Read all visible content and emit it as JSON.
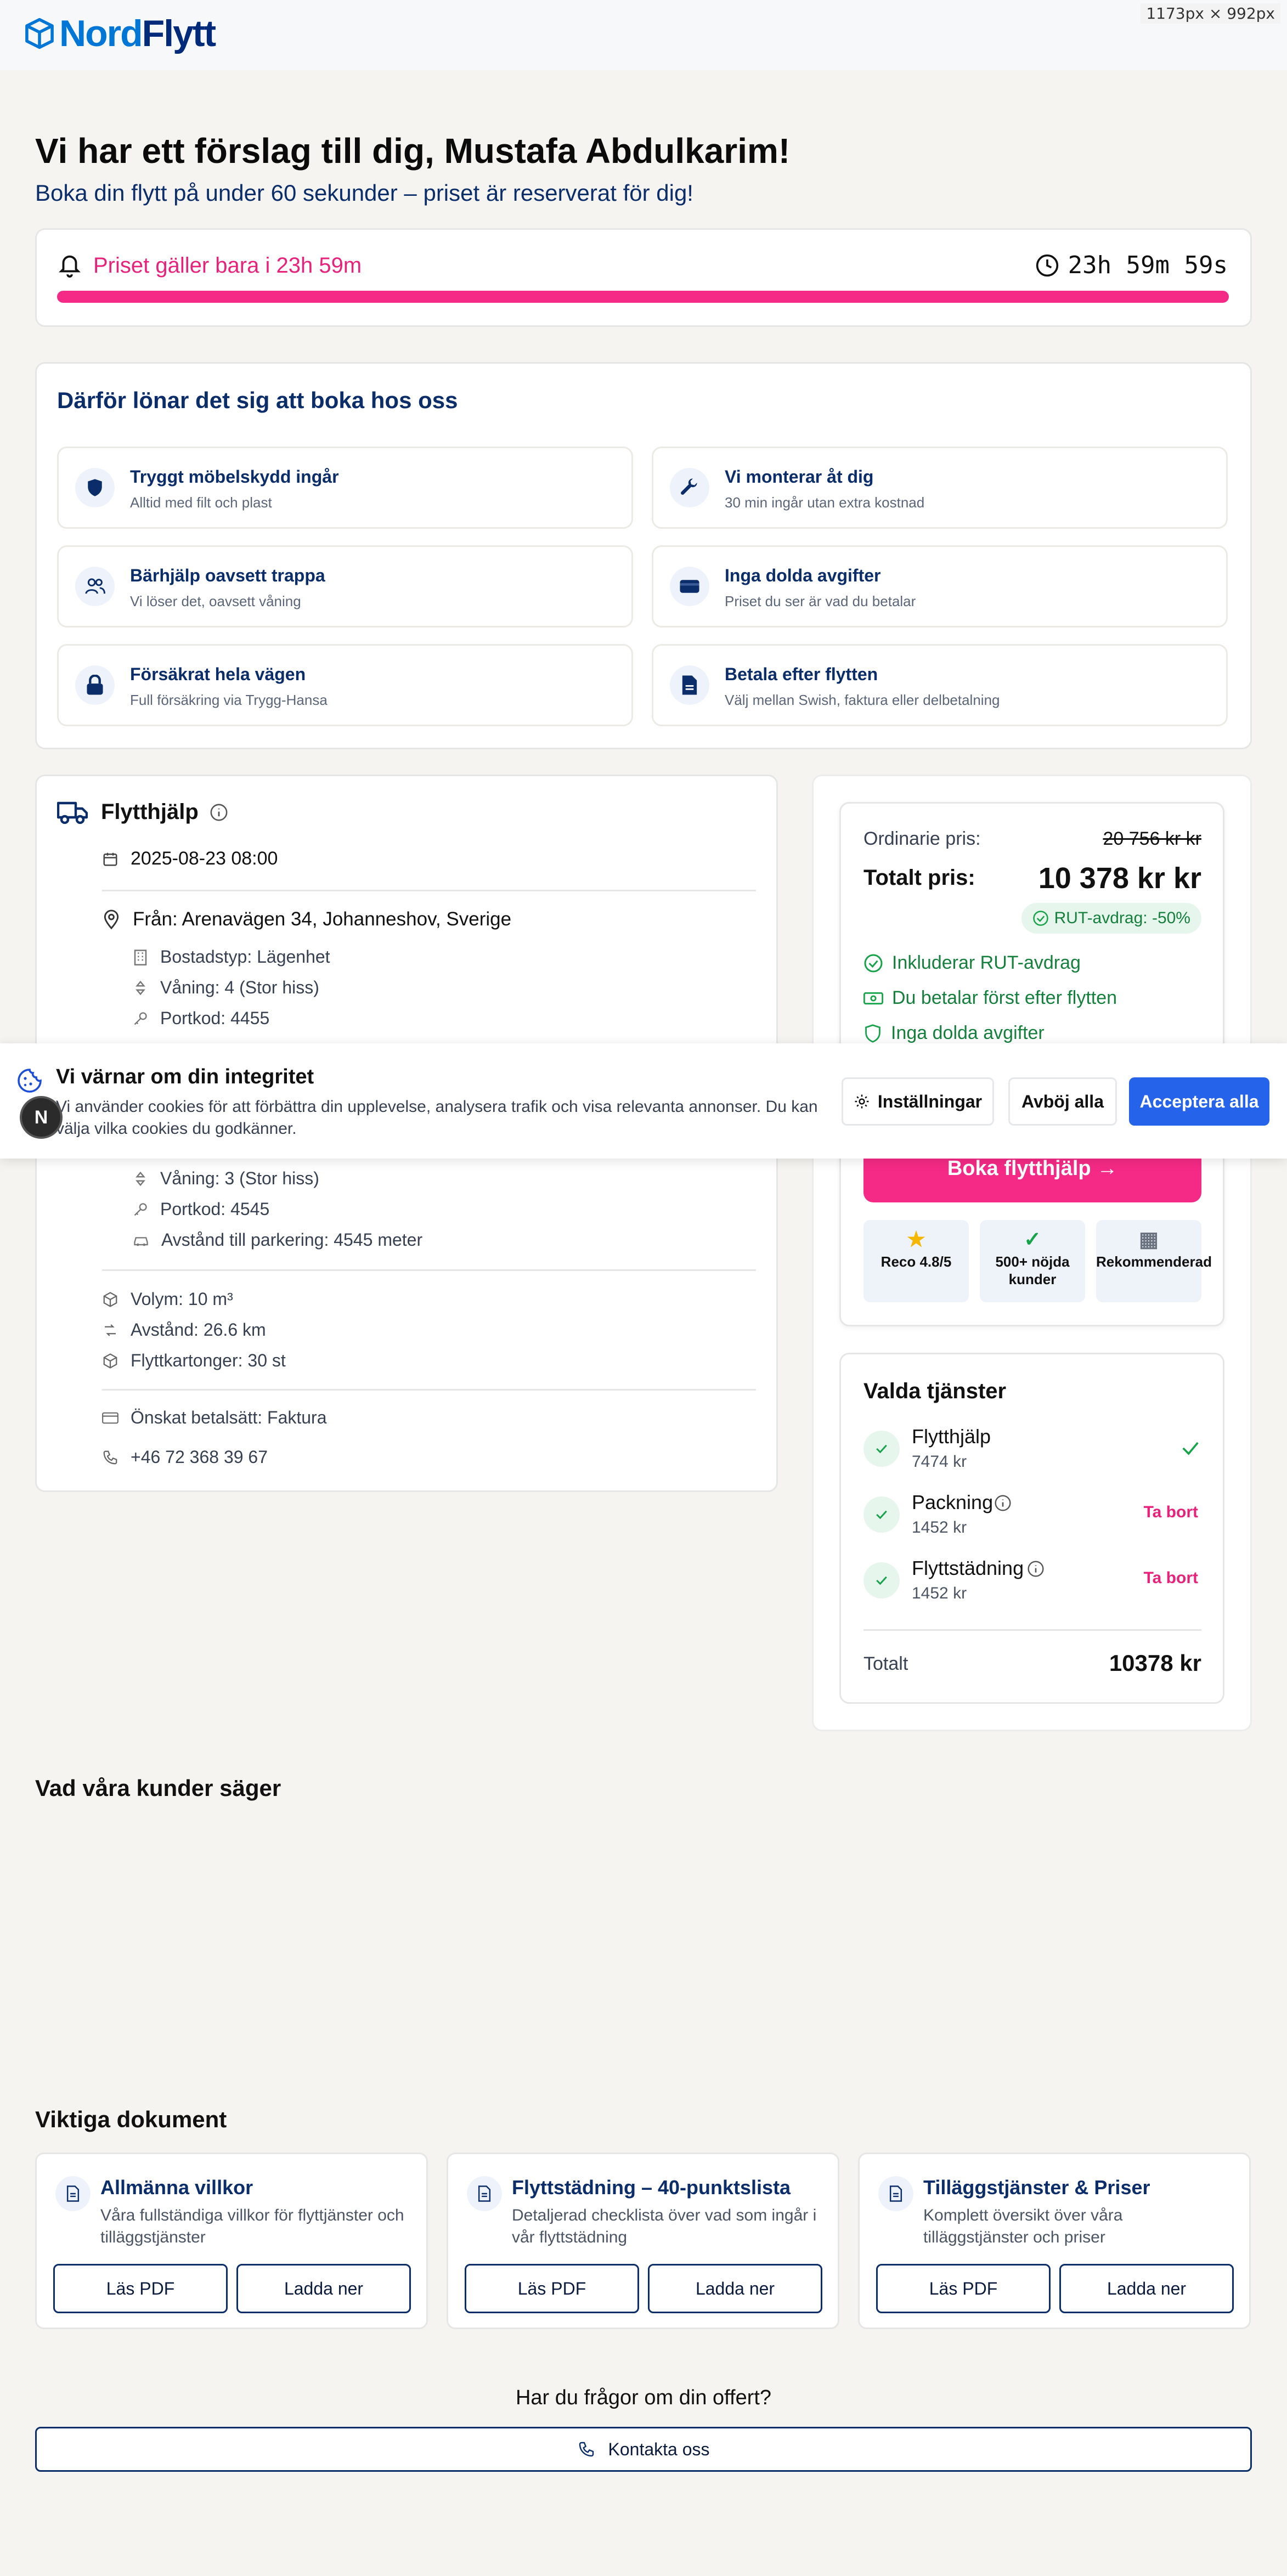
{
  "window": {
    "size_badge": "1173px × 992px"
  },
  "brand": {
    "logo_part1": "Nord",
    "logo_part2": "Flytt"
  },
  "hero": {
    "title": "Vi har ett förslag till dig, Mustafa Abdulkarim!",
    "subtitle": "Boka din flytt på under 60 sekunder – priset är reserverat för dig!"
  },
  "timer": {
    "label": "Priset gäller bara i 23h 59m",
    "countdown": "23h 59m 59s",
    "progress_fraction": 1.0
  },
  "why": {
    "title": "Därför lönar det sig att boka hos oss",
    "features": [
      {
        "title": "Tryggt möbelskydd ingår",
        "sub": "Alltid med filt och plast",
        "icon": "shield-icon"
      },
      {
        "title": "Vi monterar åt dig",
        "sub": "30 min ingår utan extra kostnad",
        "icon": "wrench-icon"
      },
      {
        "title": "Bärhjälp oavsett trappa",
        "sub": "Vi löser det, oavsett våning",
        "icon": "people-icon"
      },
      {
        "title": "Inga dolda avgifter",
        "sub": "Priset du ser är vad du betalar",
        "icon": "card-icon"
      },
      {
        "title": "Försäkrat hela vägen",
        "sub": "Full försäkring via Trygg-Hansa",
        "icon": "lock-icon"
      },
      {
        "title": "Betala efter flytten",
        "sub": "Välj mellan Swish, faktura eller delbetalning",
        "icon": "document-icon"
      }
    ]
  },
  "booking": {
    "title": "Flytthjälp",
    "datetime": "2025-08-23 08:00",
    "from": "Från: Arenavägen 34, Johanneshov, Sverige",
    "from_details": [
      "Bostadstyp: Lägenhet",
      "Våning: 4 (Stor hiss)",
      "Portkod: 4455"
    ],
    "to_details": [
      "Våning: 3 (Stor hiss)",
      "Portkod: 4545",
      "Avstånd till parkering: 4545 meter"
    ],
    "volume": "Volym: 10 m³",
    "distance": "Avstånd: 26.6 km",
    "boxes": "Flyttkartonger: 30 st",
    "payment": "Önskat betalsätt: Faktura",
    "phone": "+46 72 368 39 67"
  },
  "price": {
    "ordinary_label": "Ordinarie pris:",
    "ordinary_value": "20 756 kr kr",
    "total_label": "Totalt pris:",
    "total_value": "10 378 kr kr",
    "rut_badge": "RUT-avdrag: -50%",
    "bullets": [
      "Inkluderar RUT-avdrag",
      "Du betalar först efter flytten",
      "Inga dolda avgifter"
    ],
    "cta": "Boka flytthjälp →",
    "trust": [
      {
        "icon": "★",
        "label": "Reco 4.8/5"
      },
      {
        "icon": "✓",
        "label": "500+ nöjda kunder"
      },
      {
        "icon": "▦",
        "label": "Rekommenderad"
      }
    ]
  },
  "services": {
    "title": "Valda tjänster",
    "items": [
      {
        "name": "Flytthjälp",
        "price": "7474 kr",
        "action": ""
      },
      {
        "name": "Packning",
        "price": "1452 kr",
        "action": "Ta bort"
      },
      {
        "name": "Flyttstädning",
        "price": "1452 kr",
        "action": "Ta bort"
      }
    ],
    "total_label": "Totalt",
    "total_value": "10378 kr"
  },
  "cookie": {
    "title": "Vi värnar om din integritet",
    "text": "Vi använder cookies för att förbättra din upplevelse, analysera trafik och visa relevanta annonser. Du kan välja vilka cookies du godkänner.",
    "settings": "Inställningar",
    "reject": "Avböj alla",
    "accept": "Acceptera alla",
    "badge": "N"
  },
  "testimonials": {
    "title": "Vad våra kunder säger"
  },
  "documents": {
    "title": "Viktiga dokument",
    "items": [
      {
        "title": "Allmänna villkor",
        "sub": "Våra fullständiga villkor för flyttjänster och tilläggstjänster",
        "read": "Läs PDF",
        "download": "Ladda ner"
      },
      {
        "title": "Flyttstädning – 40-punktslista",
        "sub": "Detaljerad checklista över vad som ingår i vår flyttstädning",
        "read": "Läs PDF",
        "download": "Ladda ner"
      },
      {
        "title": "Tilläggstjänster & Priser",
        "sub": "Komplett översikt över våra tilläggstjänster och priser",
        "read": "Läs PDF",
        "download": "Ladda ner"
      }
    ]
  },
  "contact": {
    "question": "Har du frågor om din offert?",
    "button": "Kontakta oss"
  },
  "colors": {
    "brand": "#0b2e6b",
    "accent": "#f52a86",
    "primary_button": "#2563eb",
    "success": "#16a34a"
  }
}
